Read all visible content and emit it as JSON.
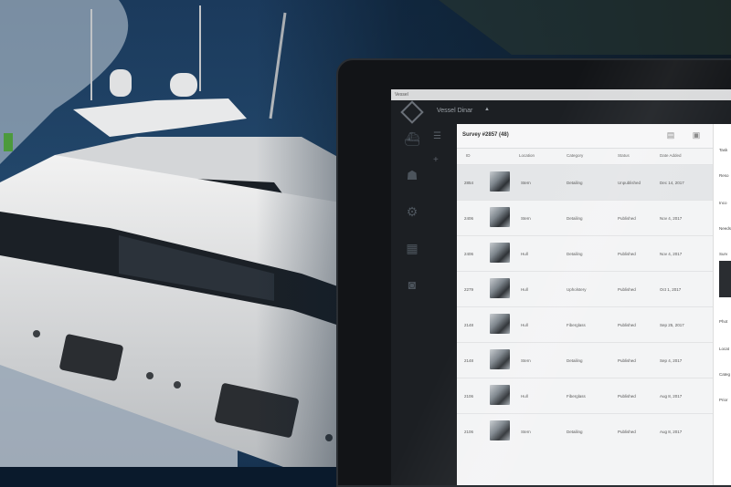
{
  "window": {
    "title": "Vessel"
  },
  "appbar": {
    "vessel_name": "Vessel Dinar",
    "caret": "▲"
  },
  "sidebar": {
    "icons": [
      "ship-icon",
      "people-icon",
      "gear-icon",
      "calendar-icon",
      "camera-icon"
    ]
  },
  "panel": {
    "title": "Survey #2857 (48)",
    "columns": [
      "ID",
      "Location",
      "Category",
      "Status",
      "Date Added"
    ],
    "rows": [
      {
        "id": "2854",
        "location": "Stern",
        "category": "Detailing",
        "status": "Unpublished",
        "date": "Dec 14, 2017",
        "selected": true
      },
      {
        "id": "2406",
        "location": "Stern",
        "category": "Detailing",
        "status": "Published",
        "date": "Nov 4, 2017",
        "selected": false
      },
      {
        "id": "2406",
        "location": "Hull",
        "category": "Detailing",
        "status": "Published",
        "date": "Nov 4, 2017",
        "selected": false
      },
      {
        "id": "2279",
        "location": "Hull",
        "category": "Upholstery",
        "status": "Published",
        "date": "Oct 1, 2017",
        "selected": false
      },
      {
        "id": "2148",
        "location": "Hull",
        "category": "Fiberglass",
        "status": "Published",
        "date": "Sep 25, 2017",
        "selected": false
      },
      {
        "id": "2148",
        "location": "Stern",
        "category": "Detailing",
        "status": "Published",
        "date": "Sep 4, 2017",
        "selected": false
      },
      {
        "id": "2106",
        "location": "Hull",
        "category": "Fiberglass",
        "status": "Published",
        "date": "Aug 8, 2017",
        "selected": false
      },
      {
        "id": "2106",
        "location": "Stern",
        "category": "Detailing",
        "status": "Published",
        "date": "Aug 8, 2017",
        "selected": false
      }
    ]
  },
  "detail": {
    "labels": [
      "Task",
      "Reso",
      "Inco",
      "Needs",
      "Surv",
      "Phot",
      "Locat",
      "Categ",
      "Prior"
    ]
  }
}
